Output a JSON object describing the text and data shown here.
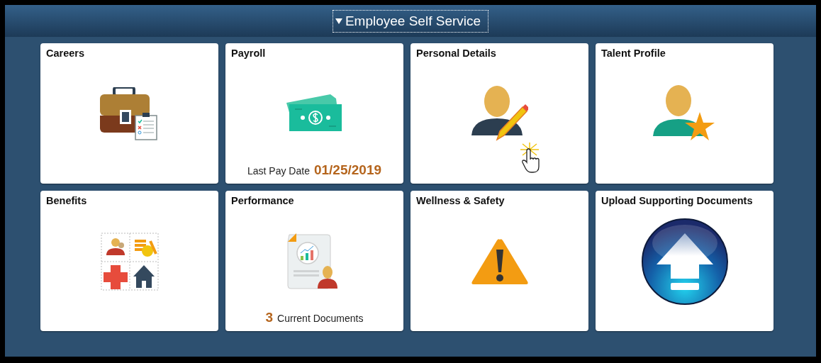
{
  "header": {
    "title": "Employee Self Service"
  },
  "tiles": [
    {
      "title": "Careers",
      "kind": "briefcase",
      "pointer": false
    },
    {
      "title": "Payroll",
      "kind": "money",
      "pointer": false,
      "footer": [
        {
          "kind": "label",
          "text": "Last Pay Date"
        },
        {
          "kind": "value",
          "text": "01/25/2019"
        }
      ]
    },
    {
      "title": "Personal Details",
      "kind": "profile",
      "pointer": true
    },
    {
      "title": "Talent Profile",
      "kind": "talent",
      "pointer": false
    },
    {
      "title": "Benefits",
      "kind": "benefits",
      "pointer": false
    },
    {
      "title": "Performance",
      "kind": "performance",
      "pointer": false,
      "footer": [
        {
          "kind": "value",
          "text": "3"
        },
        {
          "kind": "label",
          "text": "Current Documents"
        }
      ]
    },
    {
      "title": "Wellness & Safety",
      "kind": "warning",
      "pointer": false
    },
    {
      "title": "Upload Supporting Documents",
      "kind": "upload",
      "pointer": false
    }
  ]
}
